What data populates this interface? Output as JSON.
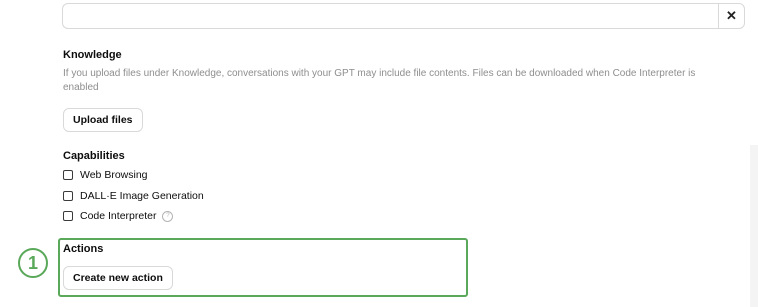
{
  "conversation_starter": {
    "value": "",
    "remove_icon": "✕"
  },
  "knowledge": {
    "title": "Knowledge",
    "description": "If you upload files under Knowledge, conversations with your GPT may include file contents. Files can be downloaded when Code Interpreter is enabled",
    "upload_label": "Upload files"
  },
  "capabilities": {
    "title": "Capabilities",
    "items": [
      {
        "label": "Web Browsing",
        "checked": false
      },
      {
        "label": "DALL·E Image Generation",
        "checked": false
      },
      {
        "label": "Code Interpreter",
        "checked": false,
        "help_icon": "?"
      }
    ]
  },
  "actions": {
    "title": "Actions",
    "create_label": "Create new action"
  },
  "annotation": {
    "marker": "1",
    "color": "#5aa85a"
  }
}
